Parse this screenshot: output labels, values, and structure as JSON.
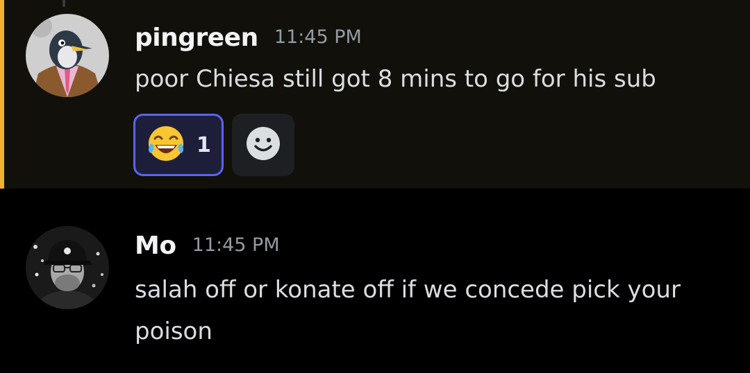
{
  "messages": [
    {
      "author": "pingreen",
      "timestamp": "11:45 PM",
      "content": "poor Chiesa still got 8 mins to go for his sub",
      "mentioned": true,
      "avatar_icon": "penguin-avatar",
      "reactions": [
        {
          "emoji_icon": "joy-emoji",
          "count": "1",
          "reacted": true
        }
      ],
      "add_reaction_icon": "smiley-add-reaction-icon"
    },
    {
      "author": "Mo",
      "timestamp": "11:45 PM",
      "content": "salah off or konate off if we concede pick your poison",
      "avatar_icon": "user-photo-avatar"
    }
  ],
  "colors": {
    "highlight_bg": "#12100b",
    "mention_bar": "#f0b232",
    "reaction_border": "#5865f2",
    "text": "#dbdee1",
    "muted": "#949ba4"
  }
}
